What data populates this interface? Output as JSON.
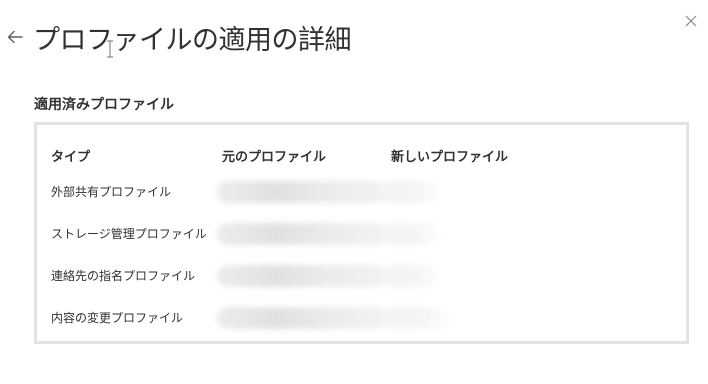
{
  "header": {
    "title": "プロファイルの適用の詳細",
    "back_icon": "arrow-left-icon",
    "close_icon": "close-icon"
  },
  "section": {
    "heading": "適用済みプロファイル"
  },
  "table": {
    "columns": [
      "タイプ",
      "元のプロファイル",
      "新しいプロファイル"
    ],
    "rows": [
      {
        "type": "外部共有プロファイル"
      },
      {
        "type": "ストレージ管理プロファイル"
      },
      {
        "type": "連絡先の指名プロファイル"
      },
      {
        "type": "内容の変更プロファイル"
      }
    ]
  },
  "colors": {
    "text": "#323130",
    "frame_border": "#e3e3e3",
    "icon": "#605e5c"
  }
}
